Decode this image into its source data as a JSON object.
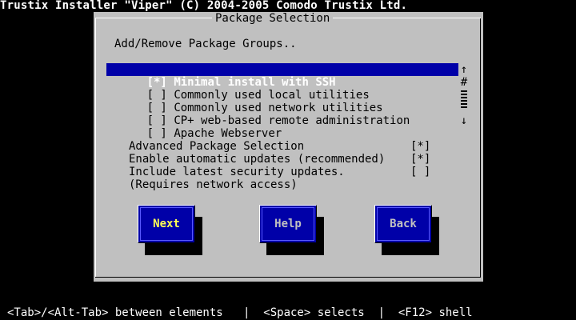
{
  "screen_title": "Trustix Installer \"Viper\" (C) 2004-2005 Comodo Trustix Ltd.",
  "dialog": {
    "title": "Package Selection",
    "section_label": "Add/Remove Package Groups..",
    "package_groups": [
      {
        "checkbox": "[*]",
        "label": "Minimal install with SSH",
        "selected": true
      },
      {
        "checkbox": "[ ]",
        "label": "Commonly used local utilities",
        "selected": false
      },
      {
        "checkbox": "[ ]",
        "label": "Commonly used network utilities",
        "selected": false
      },
      {
        "checkbox": "[ ]",
        "label": "CP+ web-based remote administration",
        "selected": false
      },
      {
        "checkbox": "[ ]",
        "label": "Apache Webserver",
        "selected": false
      }
    ],
    "scrollbar": {
      "up": "↑",
      "mark": "#",
      "down": "↓"
    },
    "options": [
      {
        "label": "Advanced Package Selection",
        "check": "[*]"
      },
      {
        "label": "Enable automatic updates (recommended)",
        "check": "[*]"
      },
      {
        "label": "Include latest security updates.",
        "check": "[ ]"
      },
      {
        "label": "(Requires network access)",
        "check": ""
      }
    ],
    "buttons": {
      "next": "Next",
      "help": "Help",
      "back": "Back"
    }
  },
  "help_line": "<Tab>/<Alt-Tab> between elements   |  <Space> selects  |  <F12> shell"
}
